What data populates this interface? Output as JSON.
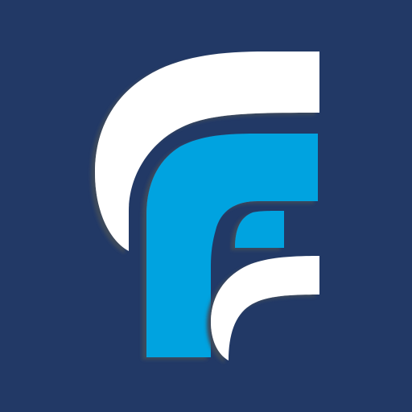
{
  "logo": {
    "icon": "stylized-letter-f-logo-icon",
    "colors": {
      "background": "#223966",
      "primary_white": "#ffffff",
      "accent_blue": "#00a3e0",
      "shadow": "#3d4a5c"
    }
  }
}
